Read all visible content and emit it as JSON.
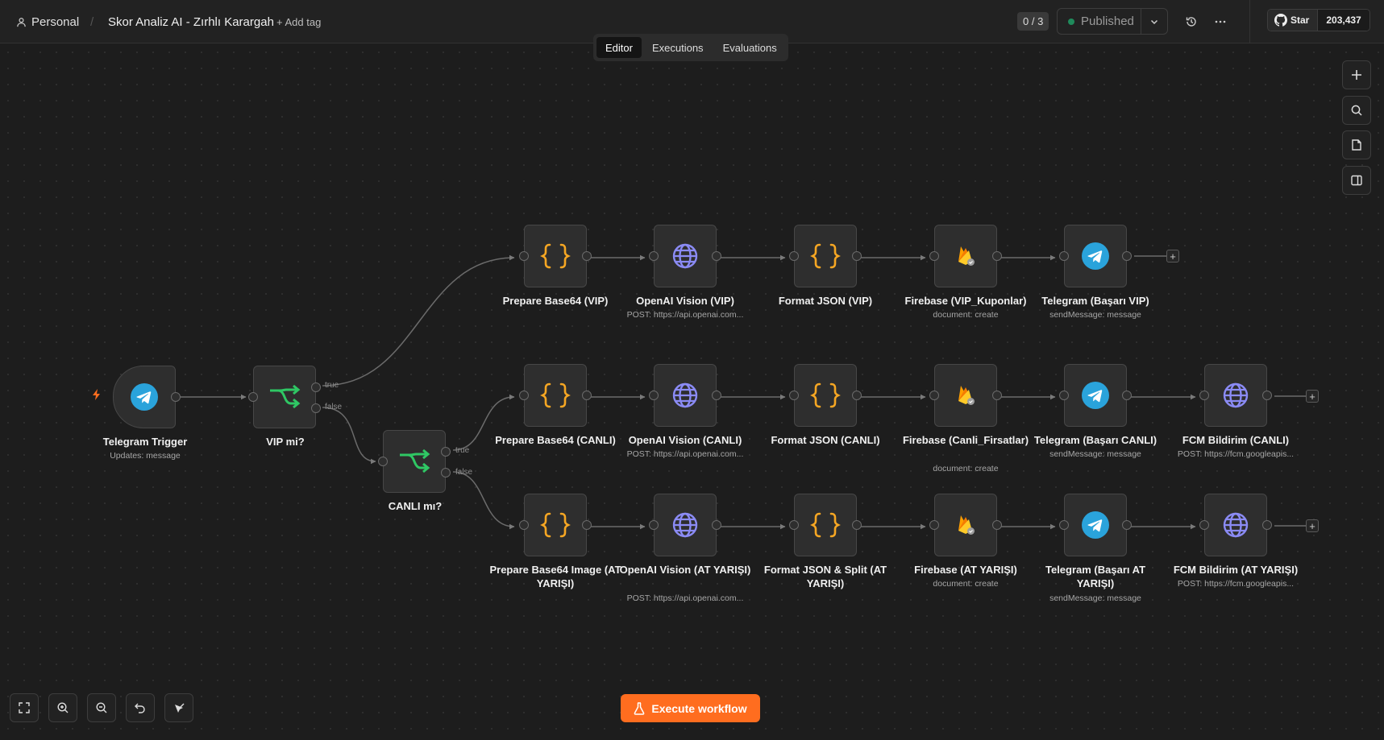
{
  "header": {
    "breadcrumb_project": "Personal",
    "breadcrumb_separator": "/",
    "workflow_name": "Skor Analiz AI - Zırhlı Karargah",
    "add_tag": "+ Add tag",
    "counter": "0 / 3",
    "publish_status": "Published",
    "star_label": "Star",
    "star_count": "203,437"
  },
  "tabs": [
    {
      "label": "Editor",
      "active": true
    },
    {
      "label": "Executions",
      "active": false
    },
    {
      "label": "Evaluations",
      "active": false
    }
  ],
  "nodes": {
    "telegram_trigger": {
      "label": "Telegram Trigger",
      "sub": "Updates: message",
      "icon": "telegram-icon"
    },
    "vip_if": {
      "label": "VIP mi?",
      "icon": "if-branch-icon",
      "out_true": "true",
      "out_false": "false"
    },
    "canli_if": {
      "label": "CANLI mı?",
      "icon": "if-branch-icon",
      "out_true": "true",
      "out_false": "false"
    },
    "vip": [
      {
        "label": "Prepare Base64 (VIP)",
        "sub": "",
        "icon": "code-braces-icon"
      },
      {
        "label": "OpenAI Vision (VIP)",
        "sub": "POST: https://api.openai.com...",
        "icon": "globe-icon"
      },
      {
        "label": "Format JSON (VIP)",
        "sub": "",
        "icon": "code-braces-icon"
      },
      {
        "label": "Firebase (VIP_Kuponlar)",
        "sub": "document: create",
        "icon": "firebase-icon"
      },
      {
        "label": "Telegram (Başarı VIP)",
        "sub": "sendMessage: message",
        "icon": "telegram-icon"
      }
    ],
    "canli": [
      {
        "label": "Prepare Base64 (CANLI)",
        "sub": "",
        "icon": "code-braces-icon"
      },
      {
        "label": "OpenAI Vision (CANLI)",
        "sub": "POST: https://api.openai.com...",
        "icon": "globe-icon"
      },
      {
        "label": "Format JSON (CANLI)",
        "sub": "",
        "icon": "code-braces-icon"
      },
      {
        "label": "Firebase (Canli_Firsatlar)",
        "sub": "document: create",
        "icon": "firebase-icon"
      },
      {
        "label": "Telegram (Başarı CANLI)",
        "sub": "sendMessage: message",
        "icon": "telegram-icon"
      },
      {
        "label": "FCM Bildirim (CANLI)",
        "sub": "POST: https://fcm.googleapis...",
        "icon": "globe-icon"
      }
    ],
    "at": [
      {
        "label": "Prepare Base64 Image (AT YARIŞI)",
        "sub": "",
        "icon": "code-braces-icon"
      },
      {
        "label": "OpenAI Vision (AT YARIŞI)",
        "sub": "POST: https://api.openai.com...",
        "icon": "globe-icon"
      },
      {
        "label": "Format JSON & Split (AT YARIŞI)",
        "sub": "",
        "icon": "code-braces-icon"
      },
      {
        "label": "Firebase (AT YARIŞI)",
        "sub": "document: create",
        "icon": "firebase-icon"
      },
      {
        "label": "Telegram (Başarı AT YARIŞI)",
        "sub": "sendMessage: message",
        "icon": "telegram-icon"
      },
      {
        "label": "FCM Bildirim (AT YARIŞI)",
        "sub": "POST: https://fcm.googleapis...",
        "icon": "globe-icon"
      }
    ]
  },
  "add_node_symbol": "+",
  "execute_button": "Execute workflow",
  "colors": {
    "accent_orange": "#ff6d1f",
    "telegram_blue": "#2aa3db",
    "if_green": "#2fc764",
    "code_orange": "#f5a623",
    "globe_purple": "#8b8bf5"
  }
}
